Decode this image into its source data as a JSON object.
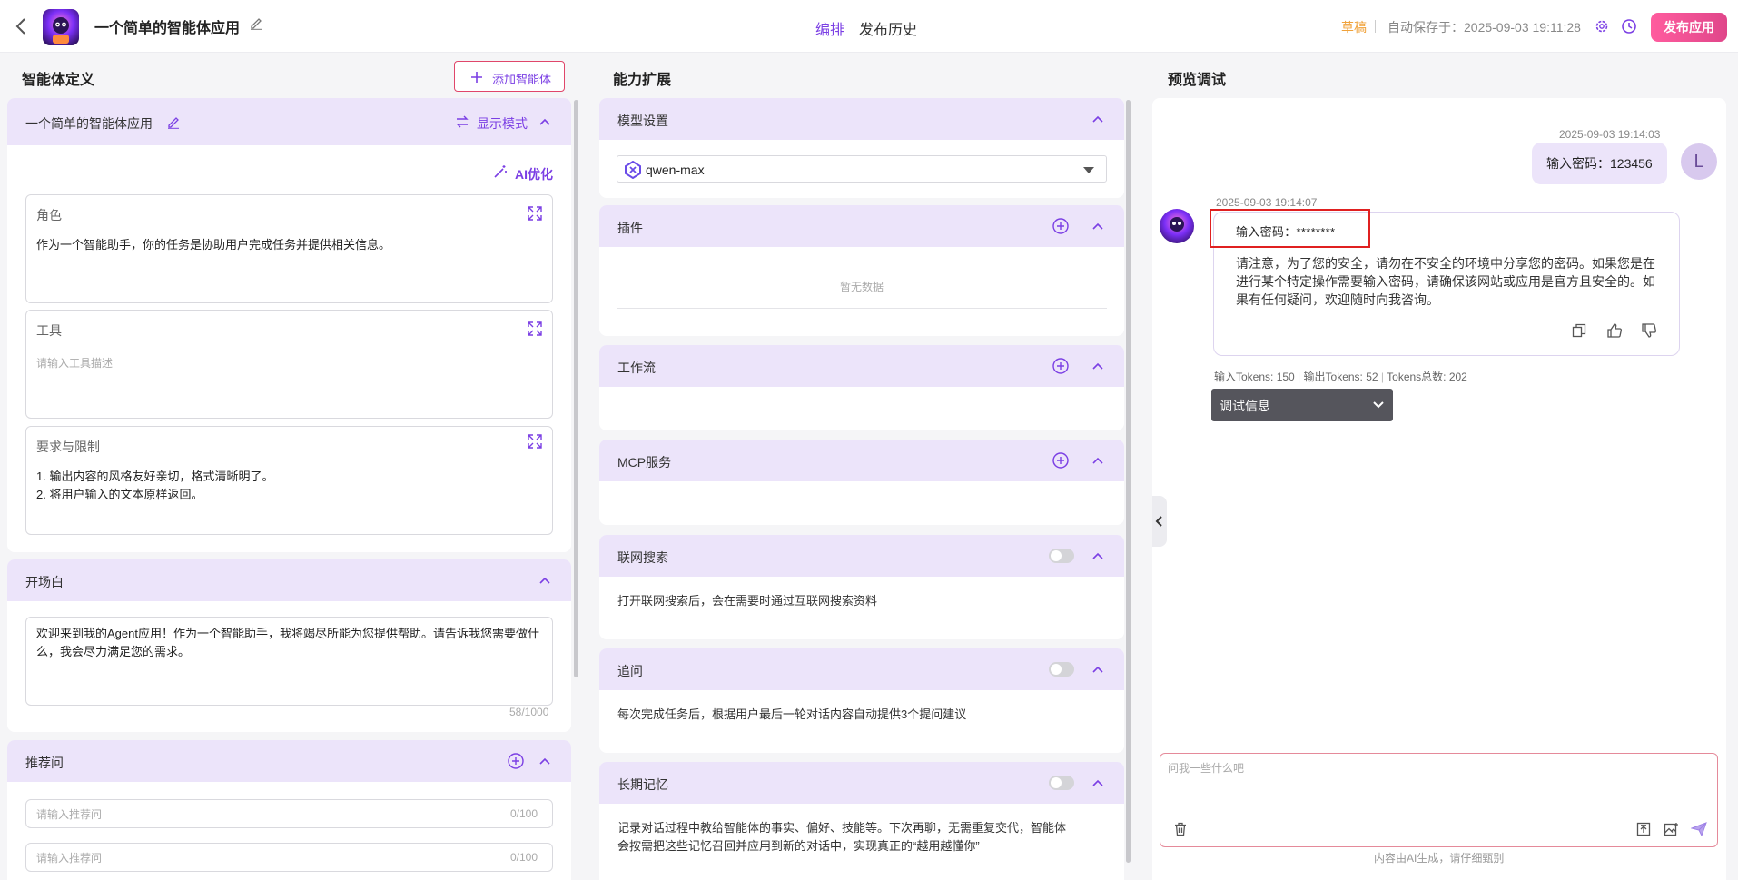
{
  "header": {
    "app_name": "一个简单的智能体应用",
    "tabs": [
      "编排",
      "发布历史"
    ],
    "status": "草稿",
    "autosave": "自动保存于：2025-09-03 19:11:28",
    "publish_label": "发布应用",
    "accent": "#7b3fe4"
  },
  "left": {
    "title": "智能体定义",
    "add_agent_label": "添加智能体",
    "agent": {
      "name": "一个简单的智能体应用",
      "display_mode_label": "显示模式",
      "ai_optimize_label": "AI优化",
      "role": {
        "label": "角色",
        "text": "作为一个智能助手，你的任务是协助用户完成任务并提供相关信息。"
      },
      "tools": {
        "label": "工具",
        "placeholder": "请输入工具描述"
      },
      "limits": {
        "label": "要求与限制",
        "line1": "1. 输出内容的风格友好亲切，格式清晰明了。",
        "line2": "2. 将用户输入的文本原样返回。"
      }
    },
    "opening": {
      "title": "开场白",
      "text": "欢迎来到我的Agent应用！作为一个智能助手，我将竭尽所能为您提供帮助。请告诉我您需要做什么，我会尽力满足您的需求。",
      "count": "58/1000"
    },
    "recommend": {
      "title": "推荐问",
      "placeholder": "请输入推荐问",
      "count": "0/100"
    }
  },
  "middle": {
    "title": "能力扩展",
    "model": {
      "title": "模型设置",
      "value": "qwen-max"
    },
    "plugins": {
      "title": "插件",
      "empty": "暂无数据"
    },
    "workflow": {
      "title": "工作流"
    },
    "mcp": {
      "title": "MCP服务"
    },
    "web_search": {
      "title": "联网搜索",
      "desc": "打开联网搜索后，会在需要时通过互联网搜索资料",
      "enabled": false
    },
    "followup": {
      "title": "追问",
      "desc": "每次完成任务后，根据用户最后一轮对话内容自动提供3个提问建议",
      "enabled": false
    },
    "memory": {
      "title": "长期记忆",
      "desc1": "记录对话过程中教给智能体的事实、偏好、技能等。下次再聊，无需重复交代，智能体",
      "desc2": "会按需把这些记忆召回并应用到新的对话中，实现真正的“越用越懂你”",
      "enabled": false
    }
  },
  "right": {
    "title": "预览调试",
    "user_msg": {
      "time": "2025-09-03 19:14:03",
      "text": "输入密码：123456",
      "avatar_letter": "L"
    },
    "bot_msg": {
      "time": "2025-09-03 19:14:07",
      "echo": "输入密码：********",
      "line1": "请注意，为了您的安全，请勿在不安全的环境中分享您的密码。如果您是在",
      "line2": "进行某个特定操作需要输入密码，请确保该网站或应用是官方且安全的。如",
      "line3": "果有任何疑问，欢迎随时向我咨询。"
    },
    "tokens": {
      "input": "输入Tokens: 150",
      "output": "输出Tokens: 52",
      "total": "Tokens总数: 202"
    },
    "debug_label": "调试信息",
    "chat_placeholder": "问我一些什么吧",
    "footer_note": "内容由AI生成，请仔细甄别",
    "highlight_color": "#e02020"
  }
}
